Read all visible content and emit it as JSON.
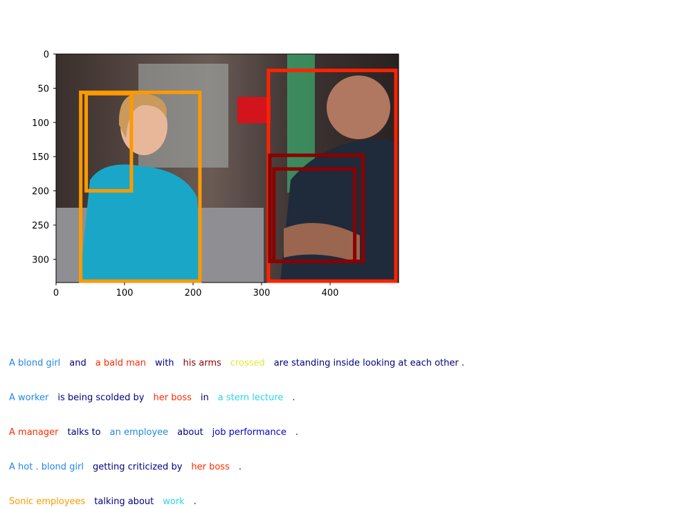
{
  "figure": {
    "x_ticks": [
      "0",
      "100",
      "200",
      "300",
      "400"
    ],
    "y_ticks": [
      "0",
      "50",
      "100",
      "150",
      "200",
      "250",
      "300"
    ],
    "image_extent": {
      "x_max": 500,
      "y_max": 334
    },
    "photo_description_colors": {
      "kitchen_bg": "#5b4a44",
      "girl_shirt": "#1aa7c7",
      "man_shirt": "#1f2a3a",
      "green_light": "#3cc37a"
    },
    "boxes": [
      {
        "id": "box-a-blond-girl",
        "color": "#ff9900",
        "x0": 36,
        "y0": 56,
        "x1": 210,
        "y1": 332
      },
      {
        "id": "box-ponytail",
        "color": "#ff9900",
        "x0": 44,
        "y0": 58,
        "x1": 110,
        "y1": 200
      },
      {
        "id": "box-bald-man",
        "color": "#ff2200",
        "x0": 310,
        "y0": 24,
        "x1": 496,
        "y1": 332
      },
      {
        "id": "box-his-arms",
        "color": "#8b0000",
        "x0": 312,
        "y0": 148,
        "x1": 448,
        "y1": 303
      },
      {
        "id": "box-crossed",
        "color": "#8b0000",
        "x0": 318,
        "y0": 168,
        "x1": 436,
        "y1": 303
      }
    ]
  },
  "captions": [
    [
      {
        "text": "A blond girl",
        "color": "#1f87e8"
      },
      {
        "text": "and",
        "color": "#000080"
      },
      {
        "text": "a bald man",
        "color": "#ff2a00"
      },
      {
        "text": "with",
        "color": "#000080"
      },
      {
        "text": "his arms",
        "color": "#8b0000"
      },
      {
        "text": "crossed",
        "color": "#e5e635"
      },
      {
        "text": "are standing inside looking at each other .",
        "color": "#000080"
      }
    ],
    [
      {
        "text": "A worker",
        "color": "#1f87e8"
      },
      {
        "text": "is being scolded by",
        "color": "#000080"
      },
      {
        "text": "her boss",
        "color": "#ff2a00"
      },
      {
        "text": "in",
        "color": "#000080"
      },
      {
        "text": "a stern lecture",
        "color": "#2ad4e6"
      },
      {
        "text": ".",
        "color": "#000080"
      }
    ],
    [
      {
        "text": "A manager",
        "color": "#ff2a00"
      },
      {
        "text": "talks to",
        "color": "#000080"
      },
      {
        "text": "an employee",
        "color": "#1f87e8"
      },
      {
        "text": "about",
        "color": "#000080"
      },
      {
        "text": "job performance",
        "color": "#0000cd"
      },
      {
        "text": ".",
        "color": "#000080"
      }
    ],
    [
      {
        "text": "A hot . blond girl",
        "color": "#1f87e8"
      },
      {
        "text": "getting criticized by",
        "color": "#000080"
      },
      {
        "text": "her boss",
        "color": "#ff2a00"
      },
      {
        "text": ".",
        "color": "#000080"
      }
    ],
    [
      {
        "text": "Sonic employees",
        "color": "#ff9900"
      },
      {
        "text": "talking about",
        "color": "#000080"
      },
      {
        "text": "work",
        "color": "#2ad4e6"
      },
      {
        "text": ".",
        "color": "#000080"
      }
    ]
  ]
}
